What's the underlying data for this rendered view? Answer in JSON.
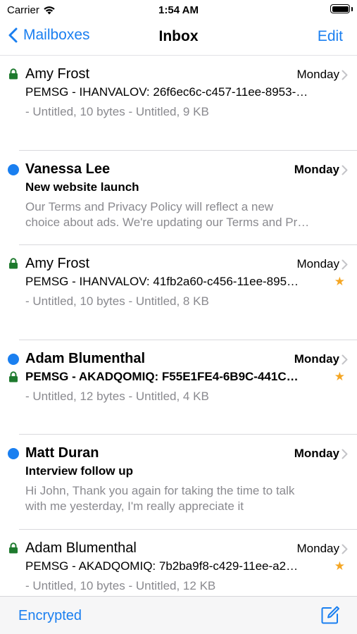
{
  "status_bar": {
    "carrier": "Carrier",
    "time": "1:54 AM"
  },
  "nav": {
    "back_label": "Mailboxes",
    "title": "Inbox",
    "edit_label": "Edit"
  },
  "messages": [
    {
      "sender": "Amy Frost",
      "date": "Monday",
      "subject": "PEMSG - IHANVALOV: 26f6ec6c-c457-11ee-8953-…",
      "preview": [
        "- Untitled, 10 bytes - Untitled, 9 KB"
      ]
    },
    {
      "sender": "Vanessa Lee",
      "date": "Monday",
      "subject": "New website launch",
      "preview": [
        "Our Terms and Privacy Policy will reflect a new",
        "choice about ads. We're updating our Terms and Pr…"
      ]
    },
    {
      "sender": "Amy Frost",
      "date": "Monday",
      "subject": "PEMSG - IHANVALOV: 41fb2a60-c456-11ee-895…",
      "preview": [
        "- Untitled, 10 bytes - Untitled, 8 KB"
      ]
    },
    {
      "sender": "Adam Blumenthal",
      "date": "Monday",
      "subject": "PEMSG - AKADQOMIQ: F55E1FE4-6B9C-441C…",
      "preview": [
        "- Untitled, 12 bytes - Untitled, 4 KB"
      ]
    },
    {
      "sender": "Matt Duran",
      "date": "Monday",
      "subject": "Interview follow up",
      "preview": [
        "Hi John, Thank you again for taking the time to talk",
        "with me yesterday, I'm really appreciate it"
      ]
    },
    {
      "sender": "Adam Blumenthal",
      "date": "Monday",
      "subject": "PEMSG - AKADQOMIQ: 7b2ba9f8-c429-11ee-a2…",
      "preview": [
        "- Untitled, 10 bytes - Untitled, 12 KB"
      ]
    }
  ],
  "star_glyph": "★",
  "toolbar": {
    "encrypted_label": "Encrypted"
  },
  "colors": {
    "accent": "#1a7ff0",
    "lock": "#1e7a2e",
    "star": "#f5a623",
    "preview_text": "#8a8a8f"
  }
}
